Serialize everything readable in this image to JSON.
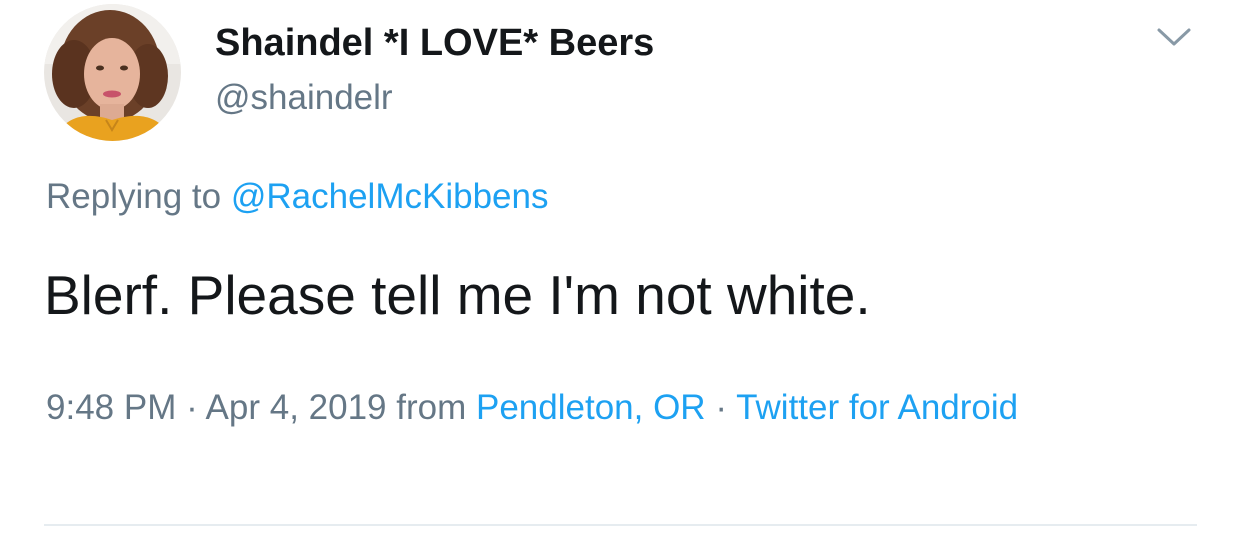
{
  "tweet": {
    "author": {
      "display_name": "Shaindel *I LOVE* Beers",
      "handle": "@shaindelr",
      "avatar_icon": "user-avatar"
    },
    "menu_icon": "chevron-down-icon",
    "reply": {
      "prefix": "Replying to",
      "mention": "@RachelMcKibbens"
    },
    "text": "Blerf. Please tell me I'm not white.",
    "meta": {
      "time": "9:48 PM",
      "separator": "·",
      "date": "Apr 4, 2019",
      "from_label": "from",
      "location": "Pendleton, OR",
      "source": "Twitter for Android"
    }
  },
  "colors": {
    "text_primary": "#14171a",
    "text_secondary": "#657786",
    "link": "#1da1f2",
    "divider": "#e6ecf0"
  }
}
